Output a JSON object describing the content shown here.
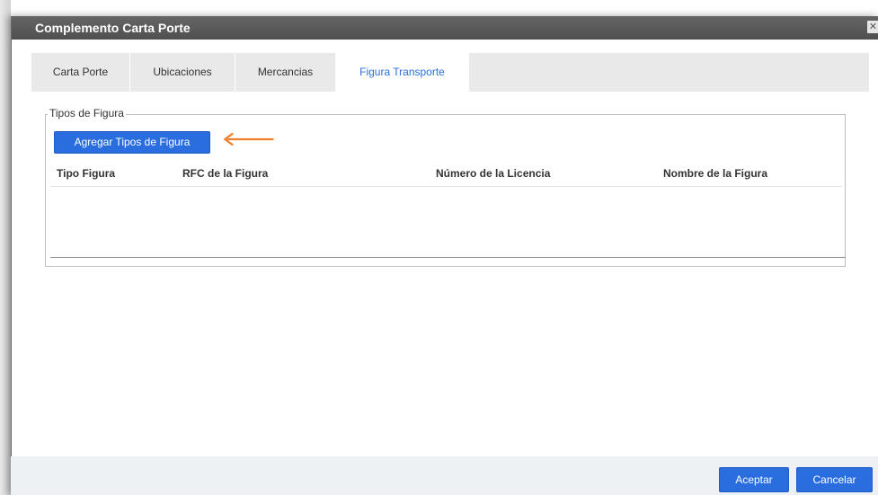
{
  "dialog": {
    "title": "Complemento Carta Porte",
    "close_icon": "close-icon"
  },
  "tabs": [
    {
      "label": "Carta Porte",
      "active": false
    },
    {
      "label": "Ubicaciones",
      "active": false
    },
    {
      "label": "Mercancias",
      "active": false
    },
    {
      "label": "Figura Transporte",
      "active": true
    }
  ],
  "section": {
    "legend": "Tipos de Figura",
    "add_button": "Agregar Tipos de Figura",
    "columns": [
      "Tipo Figura",
      "RFC de la Figura",
      "Número de la Licencia",
      "Nombre de la Figura"
    ],
    "rows": []
  },
  "footer": {
    "accept": "Aceptar",
    "cancel": "Cancelar"
  },
  "colors": {
    "accent": "#2a6ddf",
    "arrow": "#f07f2a",
    "titlebar": "#5a5a5a"
  }
}
